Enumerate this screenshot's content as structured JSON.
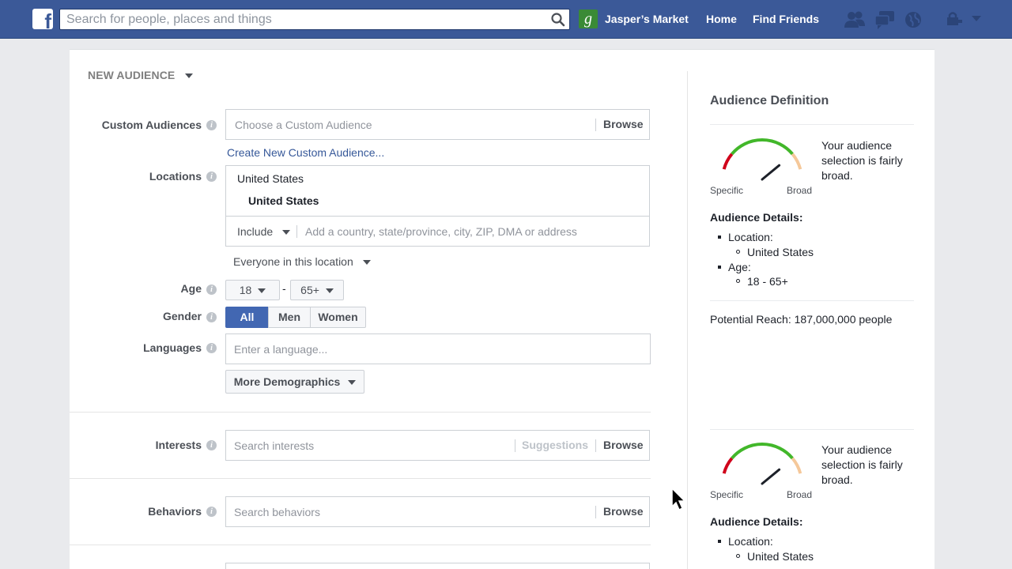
{
  "topbar": {
    "search_placeholder": "Search for people, places and things",
    "page_initial": "g",
    "page_name": "Jasper’s Market",
    "home": "Home",
    "find_friends": "Find Friends"
  },
  "form": {
    "header": "NEW AUDIENCE",
    "custom_audiences": {
      "label": "Custom Audiences",
      "placeholder": "Choose a Custom Audience",
      "browse": "Browse",
      "create_link": "Create New Custom Audience..."
    },
    "locations": {
      "label": "Locations",
      "group": "United States",
      "item": "United States",
      "include": "Include",
      "placeholder": "Add a country, state/province, city, ZIP, DMA or address",
      "scope": "Everyone in this location"
    },
    "age": {
      "label": "Age",
      "min": "18",
      "max": "65+",
      "dash": "-"
    },
    "gender": {
      "label": "Gender",
      "options": [
        "All",
        "Men",
        "Women"
      ],
      "selected": "All"
    },
    "languages": {
      "label": "Languages",
      "placeholder": "Enter a language..."
    },
    "more_demographics": "More Demographics",
    "interests": {
      "label": "Interests",
      "placeholder": "Search interests",
      "suggestions": "Suggestions",
      "browse": "Browse"
    },
    "behaviors": {
      "label": "Behaviors",
      "placeholder": "Search behaviors",
      "browse": "Browse"
    }
  },
  "definition": {
    "title": "Audience Definition",
    "gauge": {
      "specific": "Specific",
      "broad": "Broad",
      "text": "Your audience selection is fairly broad.",
      "level": 0.78
    },
    "details_title": "Audience Details:",
    "location_label": "Location:",
    "location_value": "United States",
    "age_label": "Age:",
    "age_value": "18 - 65+",
    "reach": "Potential Reach: 187,000,000 people"
  },
  "colors": {
    "brand": "#3b5998",
    "selected_button": "#4267b2",
    "link": "#365899",
    "gauge_red": "#d0021b",
    "gauge_green": "#42b72a",
    "gauge_peach": "#f5c89a"
  }
}
